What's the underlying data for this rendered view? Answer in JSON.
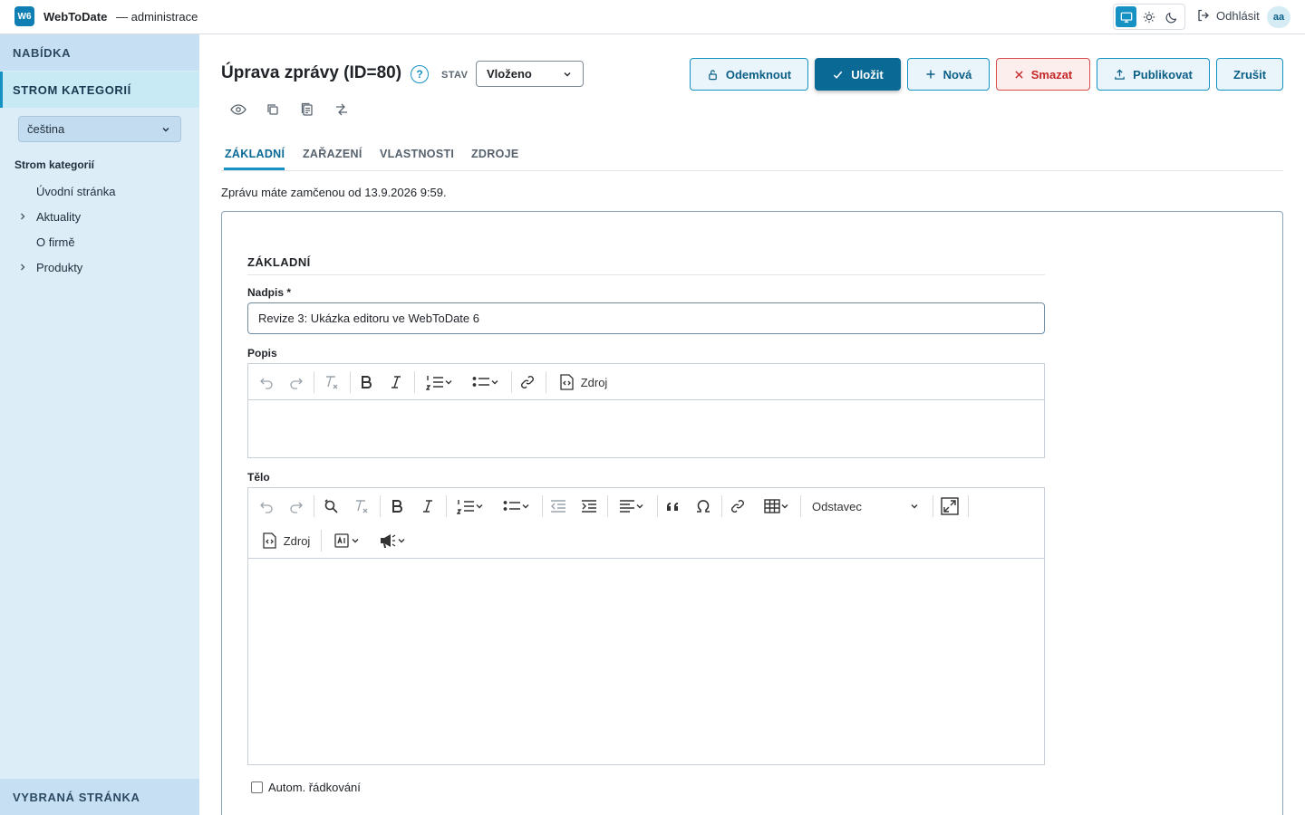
{
  "topbar": {
    "logo_badge": "W6",
    "app_name": "WebToDate",
    "app_sub": "— administrace",
    "logout_label": "Odhlásit",
    "avatar_initials": "aa",
    "theme_active": "desktop"
  },
  "sidebar": {
    "menu_heading": "NABÍDKA",
    "tree_heading": "STROM KATEGORIÍ",
    "language": "čeština",
    "tree_title": "Strom kategorií",
    "items": [
      {
        "label": "Úvodní stránka",
        "expandable": false
      },
      {
        "label": "Aktuality",
        "expandable": true
      },
      {
        "label": "O firmě",
        "expandable": false
      },
      {
        "label": "Produkty",
        "expandable": true
      }
    ],
    "selected_page_heading": "VYBRANÁ STRÁNKA"
  },
  "header": {
    "title": "Úprava zprávy (ID=80)",
    "help": "?",
    "state_label": "STAV",
    "state_value": "Vloženo"
  },
  "actions": {
    "unlock": "Odemknout",
    "save": "Uložit",
    "new": "Nová",
    "delete": "Smazat",
    "publish": "Publikovat",
    "cancel": "Zrušit"
  },
  "tabs": [
    "ZÁKLADNÍ",
    "ZAŘAZENÍ",
    "VLASTNOSTI",
    "ZDROJE"
  ],
  "active_tab": "ZÁKLADNÍ",
  "lock_message": "Zprávu máte zamčenou od 13.9.2026 9:59.",
  "form": {
    "section_title": "ZÁKLADNÍ",
    "title_label": "Nadpis *",
    "title_value": "Revize 3: Ukázka editoru ve WebToDate 6",
    "description_label": "Popis",
    "body_label": "Tělo",
    "source_label": "Zdroj",
    "paragraph_style": "Odstavec",
    "auto_wrap_label": "Autom. řádkování",
    "auto_wrap_checked": false
  },
  "colors": {
    "accent": "#1691c4",
    "primary": "#0b6a95",
    "danger": "#c62828",
    "sidebar_bg": "#dcedf8"
  }
}
